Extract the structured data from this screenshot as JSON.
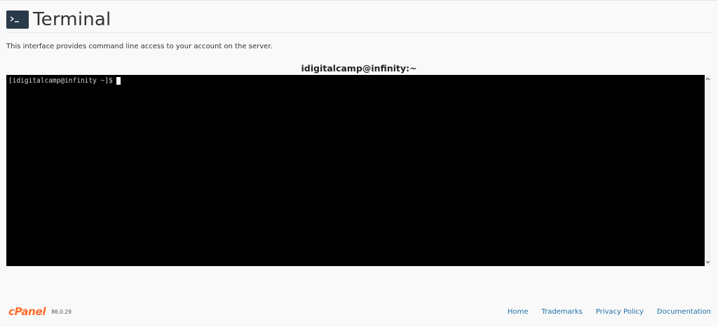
{
  "header": {
    "title": "Terminal",
    "icon": "terminal-icon"
  },
  "description": "This interface provides command line access to your account on the server.",
  "terminal": {
    "session_title": "idigitalcamp@infinity:~",
    "prompt": "[idigitalcamp@infinity ~]$",
    "background": "#000000",
    "text_color": "#d8d8d8"
  },
  "footer": {
    "logo": "cPanel",
    "version": "86.0.29",
    "links": [
      {
        "label": "Home"
      },
      {
        "label": "Trademarks"
      },
      {
        "label": "Privacy Policy"
      },
      {
        "label": "Documentation"
      }
    ]
  },
  "colors": {
    "accent": "#ff6c2c",
    "link": "#1e6fa8",
    "icon_bg": "#293a4a"
  }
}
